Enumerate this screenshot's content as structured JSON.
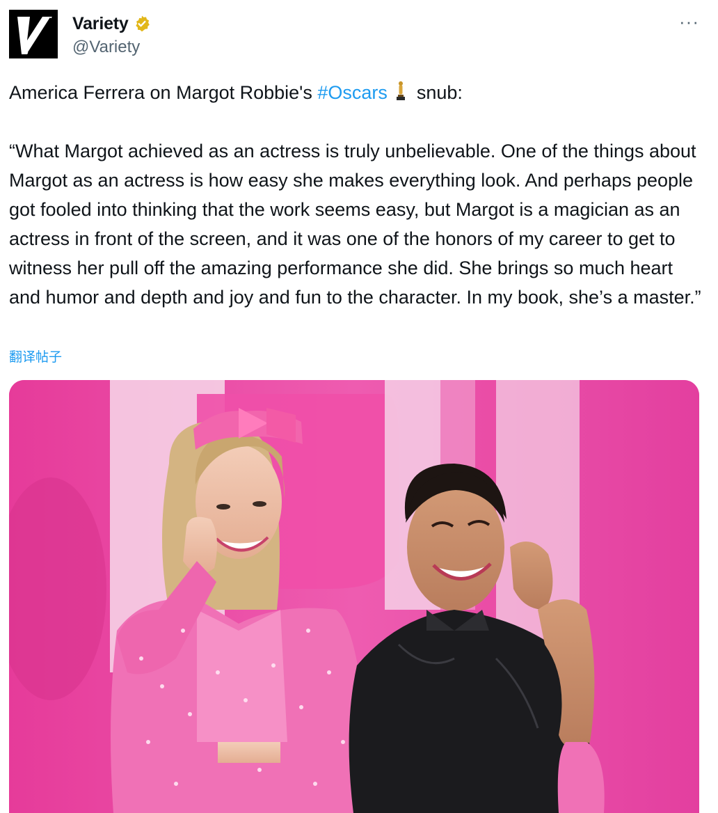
{
  "tweet": {
    "author": {
      "display_name": "Variety",
      "handle": "@Variety",
      "avatar_icon": "variety-v-logo",
      "verified_icon": "gold-verified-badge-icon",
      "verified_color": "#e2b719"
    },
    "more_icon": "more-dots-icon",
    "more_label": "···",
    "text": {
      "lead_before": "America Ferrera on Margot Robbie's ",
      "hashtag": "#Oscars",
      "lead_after": "snub:",
      "emoji_icon": "oscar-trophy-icon",
      "quote": "“What Margot achieved as an actress is truly unbelievable. One of the things about Margot as an actress is how easy she makes everything look. And perhaps people got fooled into thinking that the work seems easy, but Margot is a magician as an actress in front of the screen, and it was one of the honors of my career to get to witness her pull off the amazing performance she did. She brings so much heart and humor and depth and joy and fun to the character. In my book, she’s a master.”"
    },
    "translate_label": "翻译帖子",
    "media": {
      "subject": "photo of two women smiling in front of a pink Barbie backdrop",
      "backdrop_color": "#e8409e"
    }
  },
  "colors": {
    "text": "#0f1419",
    "secondary": "#536471",
    "link": "#1d9bf0"
  }
}
